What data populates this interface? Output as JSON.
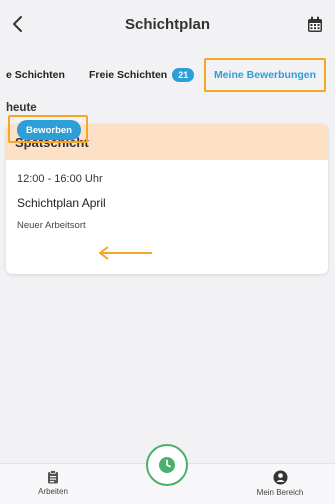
{
  "header": {
    "title": "Schichtplan"
  },
  "tabs": [
    {
      "label": "e Schichten"
    },
    {
      "label": "Freie Schichten",
      "badge": "21"
    },
    {
      "label": "Meine Bewerbungen"
    }
  ],
  "section": {
    "label": "heute"
  },
  "shift_card": {
    "title": "Spätschicht",
    "time": "12:00 - 16:00 Uhr",
    "plan": "Schichtplan April",
    "location": "Neuer Arbeitsort",
    "status_button": "Beworben"
  },
  "bottom_nav": {
    "items": [
      {
        "label": "Arbeiten",
        "icon": "clipboard-icon"
      },
      {
        "label": "Mein Bereich",
        "icon": "profile-icon"
      }
    ],
    "fab_icon": "clock-icon"
  },
  "colors": {
    "accent": "#2c9fd8",
    "highlight": "#f5a623",
    "card_header": "#fde1c6",
    "fab": "#4caf6e"
  }
}
